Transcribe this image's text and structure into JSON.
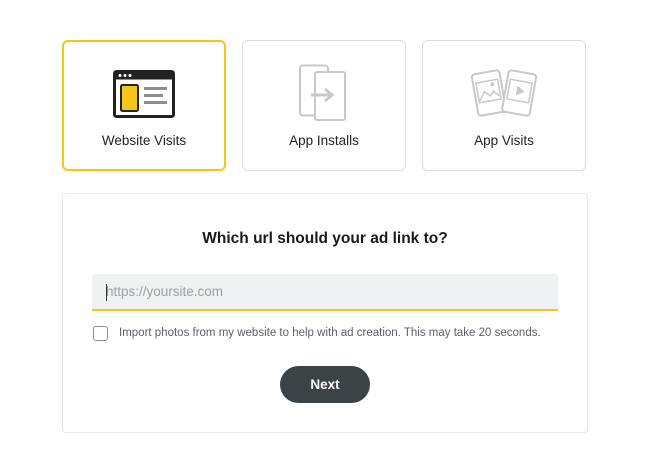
{
  "objectives": [
    {
      "label": "Website Visits",
      "icon": "browser-window-icon",
      "selected": true
    },
    {
      "label": "App Installs",
      "icon": "phone-install-icon",
      "selected": false
    },
    {
      "label": "App Visits",
      "icon": "app-cards-icon",
      "selected": false
    }
  ],
  "url_panel": {
    "title": "Which url should your ad link to?",
    "input_placeholder": "https://yoursite.com",
    "input_value": "",
    "import_label": "Import photos from my website to help with ad creation. This may take 20 seconds.",
    "import_checked": false,
    "next_label": "Next"
  },
  "colors": {
    "accent": "#f5c518",
    "button": "#3b4347",
    "icon_gray": "#c8c8c8",
    "icon_dark": "#222222"
  }
}
